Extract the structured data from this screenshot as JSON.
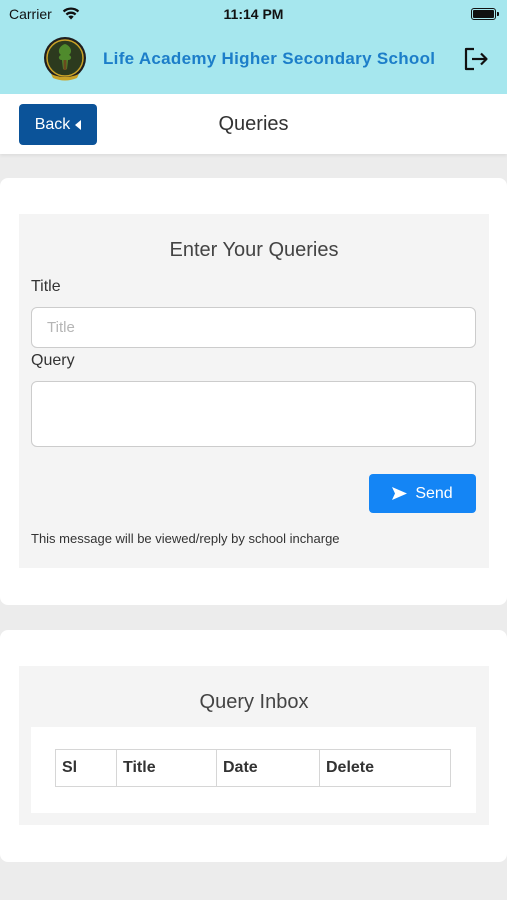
{
  "status_bar": {
    "carrier": "Carrier",
    "time": "11:14 PM"
  },
  "header": {
    "school_name": "Life Academy Higher Secondary School",
    "logo_icon": "school-crest-icon",
    "logout_icon": "logout-icon"
  },
  "nav": {
    "back_label": "Back",
    "page_title": "Queries"
  },
  "query_form": {
    "heading": "Enter Your Queries",
    "title_label": "Title",
    "title_placeholder": "Title",
    "title_value": "",
    "query_label": "Query",
    "query_value": "",
    "send_label": "Send",
    "note": "This message will be viewed/reply by school incharge"
  },
  "inbox": {
    "heading": "Query Inbox",
    "columns": [
      "Sl",
      "Title",
      "Date",
      "Delete"
    ],
    "rows": []
  },
  "colors": {
    "header_bg": "#a6e7ee",
    "school_name": "#1c7ec9",
    "back_button": "#0b5399",
    "send_button": "#1485f5",
    "page_bg": "#ececec"
  }
}
